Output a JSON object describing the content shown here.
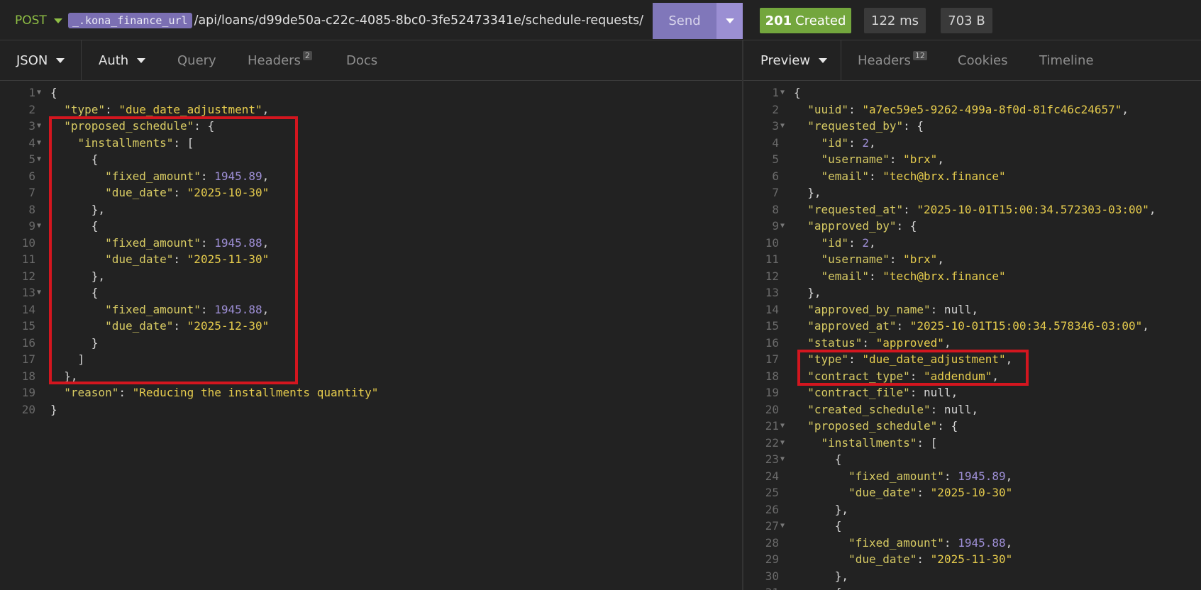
{
  "request": {
    "method": "POST",
    "url_variable": "_.kona_finance_url",
    "url_path": "/api/loans/d99de50a-c22c-4085-8bc0-3fe52473341e/schedule-requests/",
    "send_label": "Send"
  },
  "response_meta": {
    "status_code": "201",
    "status_text": "Created",
    "time": "122 ms",
    "size": "703 B",
    "status_color": "#73a63d"
  },
  "left_tabs": {
    "body_type": "JSON",
    "auth": "Auth",
    "query": "Query",
    "headers": "Headers",
    "headers_count": "2",
    "docs": "Docs"
  },
  "right_tabs": {
    "preview": "Preview",
    "headers": "Headers",
    "headers_count": "12",
    "cookies": "Cookies",
    "timeline": "Timeline"
  },
  "request_body_lines": [
    "{",
    "  \"type\": \"due_date_adjustment\",",
    "  \"proposed_schedule\": {",
    "    \"installments\": [",
    "      {",
    "        \"fixed_amount\": 1945.89,",
    "        \"due_date\": \"2025-10-30\"",
    "      },",
    "      {",
    "        \"fixed_amount\": 1945.88,",
    "        \"due_date\": \"2025-11-30\"",
    "      },",
    "      {",
    "        \"fixed_amount\": 1945.88,",
    "        \"due_date\": \"2025-12-30\"",
    "      }",
    "    ]",
    "  },",
    "  \"reason\": \"Reducing the installments quantity\"",
    "}"
  ],
  "request_fold_lines": [
    1,
    3,
    4,
    5,
    9,
    13
  ],
  "response_body_lines": [
    "{",
    "  \"uuid\": \"a7ec59e5-9262-499a-8f0d-81fc46c24657\",",
    "  \"requested_by\": {",
    "    \"id\": 2,",
    "    \"username\": \"brx\",",
    "    \"email\": \"tech@brx.finance\"",
    "  },",
    "  \"requested_at\": \"2025-10-01T15:00:34.572303-03:00\",",
    "  \"approved_by\": {",
    "    \"id\": 2,",
    "    \"username\": \"brx\",",
    "    \"email\": \"tech@brx.finance\"",
    "  },",
    "  \"approved_by_name\": null,",
    "  \"approved_at\": \"2025-10-01T15:00:34.578346-03:00\",",
    "  \"status\": \"approved\",",
    "  \"type\": \"due_date_adjustment\",",
    "  \"contract_type\": \"addendum\",",
    "  \"contract_file\": null,",
    "  \"created_schedule\": null,",
    "  \"proposed_schedule\": {",
    "    \"installments\": [",
    "      {",
    "        \"fixed_amount\": 1945.89,",
    "        \"due_date\": \"2025-10-30\"",
    "      },",
    "      {",
    "        \"fixed_amount\": 1945.88,",
    "        \"due_date\": \"2025-11-30\"",
    "      },",
    "      {"
  ],
  "response_fold_lines": [
    1,
    3,
    9,
    21,
    22,
    23,
    27
  ],
  "highlight_color": "#d3161f"
}
